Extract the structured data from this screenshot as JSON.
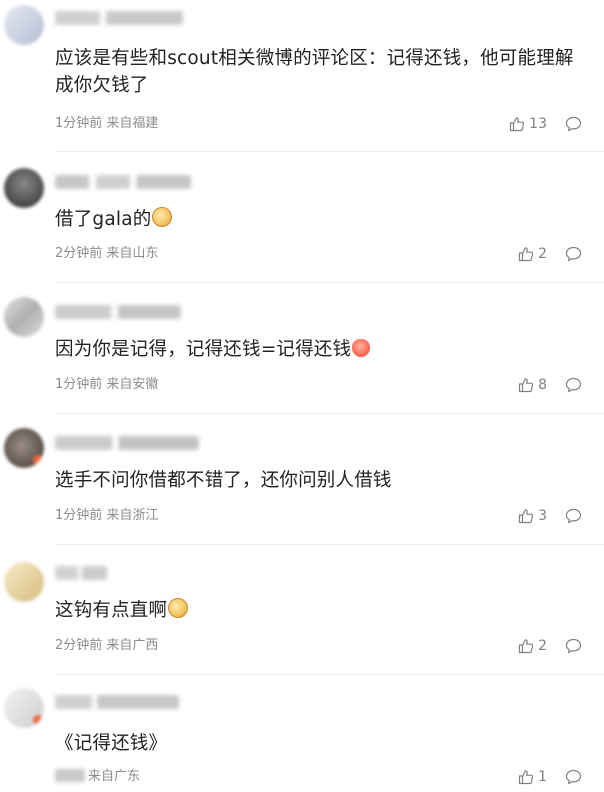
{
  "comments": [
    {
      "text": "应该是有些和scout相关微博的评论区：记得还钱，他可能理解成你欠钱了",
      "time": "1分钟前",
      "source": "来自福建",
      "likes": "13",
      "emoji": null,
      "avatar_colors": [
        "#dfe4ef",
        "#b7bfd3"
      ],
      "name_color": "#c7c7c7"
    },
    {
      "text": "借了gala的",
      "time": "2分钟前",
      "source": "来自山东",
      "likes": "2",
      "emoji": "doge",
      "avatar_colors": [
        "#6a6a6a",
        "#2b2b2b"
      ],
      "name_color": "#bdbdbd"
    },
    {
      "text": "因为你是记得，记得还钱=记得还钱",
      "time": "1分钟前",
      "source": "来自安徽",
      "likes": "8",
      "emoji": "red",
      "avatar_colors": [
        "#d9d9d9",
        "#a5a5a5"
      ],
      "name_color": "#c4c4c4"
    },
    {
      "text": "选手不问你借都不错了，还你问别人借钱",
      "time": "1分钟前",
      "source": "来自浙江",
      "likes": "3",
      "emoji": null,
      "avatar_colors": [
        "#8a7d76",
        "#4a3f3a"
      ],
      "name_color": "#c2c2c2"
    },
    {
      "text": "这钩有点直啊",
      "time": "2分钟前",
      "source": "来自广西",
      "likes": "2",
      "emoji": "doge",
      "avatar_colors": [
        "#f4e4b8",
        "#d9c08a"
      ],
      "name_color": "#cacaca"
    },
    {
      "text": "《记得还钱》",
      "time": "",
      "source": "来自广东",
      "likes": "1",
      "emoji": null,
      "avatar_colors": [
        "#ececec",
        "#cfcfcf"
      ],
      "name_color": "#c8c8c8"
    }
  ],
  "icons": {
    "like": "thumbs-up-icon",
    "reply": "comment-bubble-icon"
  }
}
